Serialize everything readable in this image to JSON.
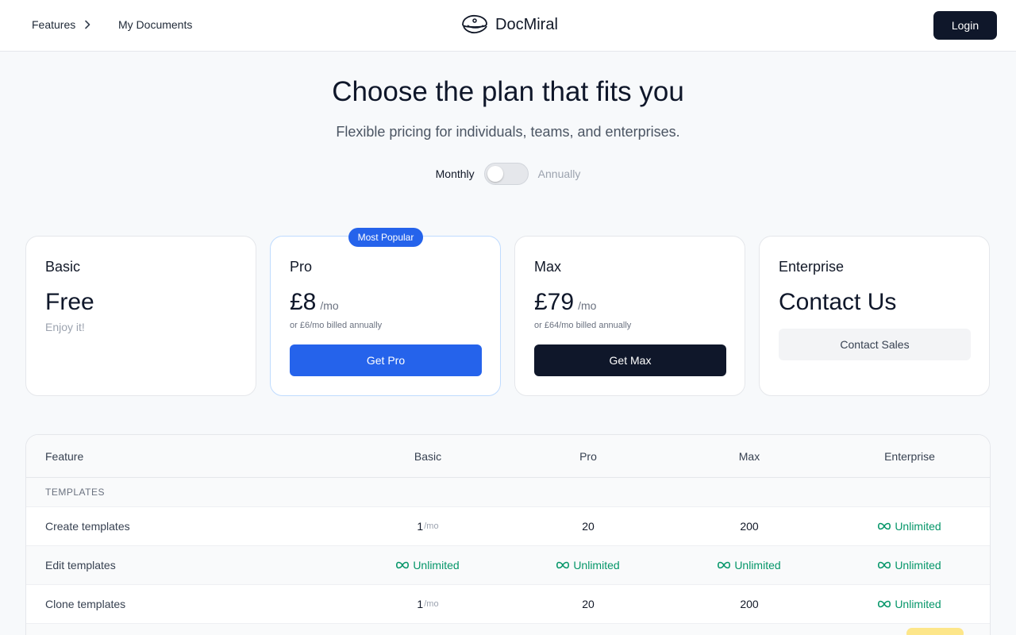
{
  "nav": {
    "features_label": "Features",
    "documents_label": "My Documents",
    "brand": "DocMiral",
    "login_label": "Login"
  },
  "hero": {
    "title": "Choose the plan that fits you",
    "subtitle": "Flexible pricing for individuals, teams, and enterprises.",
    "billing_monthly": "Monthly",
    "billing_annually": "Annually",
    "billing_toggle_state": "monthly"
  },
  "plans": [
    {
      "name": "Basic",
      "price": "Free",
      "tagline": "Enjoy it!"
    },
    {
      "name": "Pro",
      "price": "£8",
      "period": "/mo",
      "note": "or £6/mo billed annually",
      "cta": "Get Pro",
      "badge": "Most Popular"
    },
    {
      "name": "Max",
      "price": "£79",
      "period": "/mo",
      "note": "or £64/mo billed annually",
      "cta": "Get Max"
    },
    {
      "name": "Enterprise",
      "price": "Contact Us",
      "cta": "Contact Sales"
    }
  ],
  "table": {
    "headers": [
      "Feature",
      "Basic",
      "Pro",
      "Max",
      "Enterprise"
    ],
    "section": "TEMPLATES",
    "unlimited_label": "Unlimited",
    "rows": [
      {
        "feature": "Create templates",
        "basic": "1",
        "basic_unit": "/mo",
        "pro": "20",
        "max": "200",
        "enterprise": "Unlimited"
      },
      {
        "feature": "Edit templates",
        "basic": "Unlimited",
        "pro": "Unlimited",
        "max": "Unlimited",
        "enterprise": "Unlimited"
      },
      {
        "feature": "Clone templates",
        "basic": "1",
        "basic_unit": "/mo",
        "pro": "20",
        "max": "200",
        "enterprise": "Unlimited"
      }
    ]
  },
  "colors": {
    "accent": "#2563eb",
    "dark": "#0f172a",
    "unlimited_green": "#059669"
  }
}
